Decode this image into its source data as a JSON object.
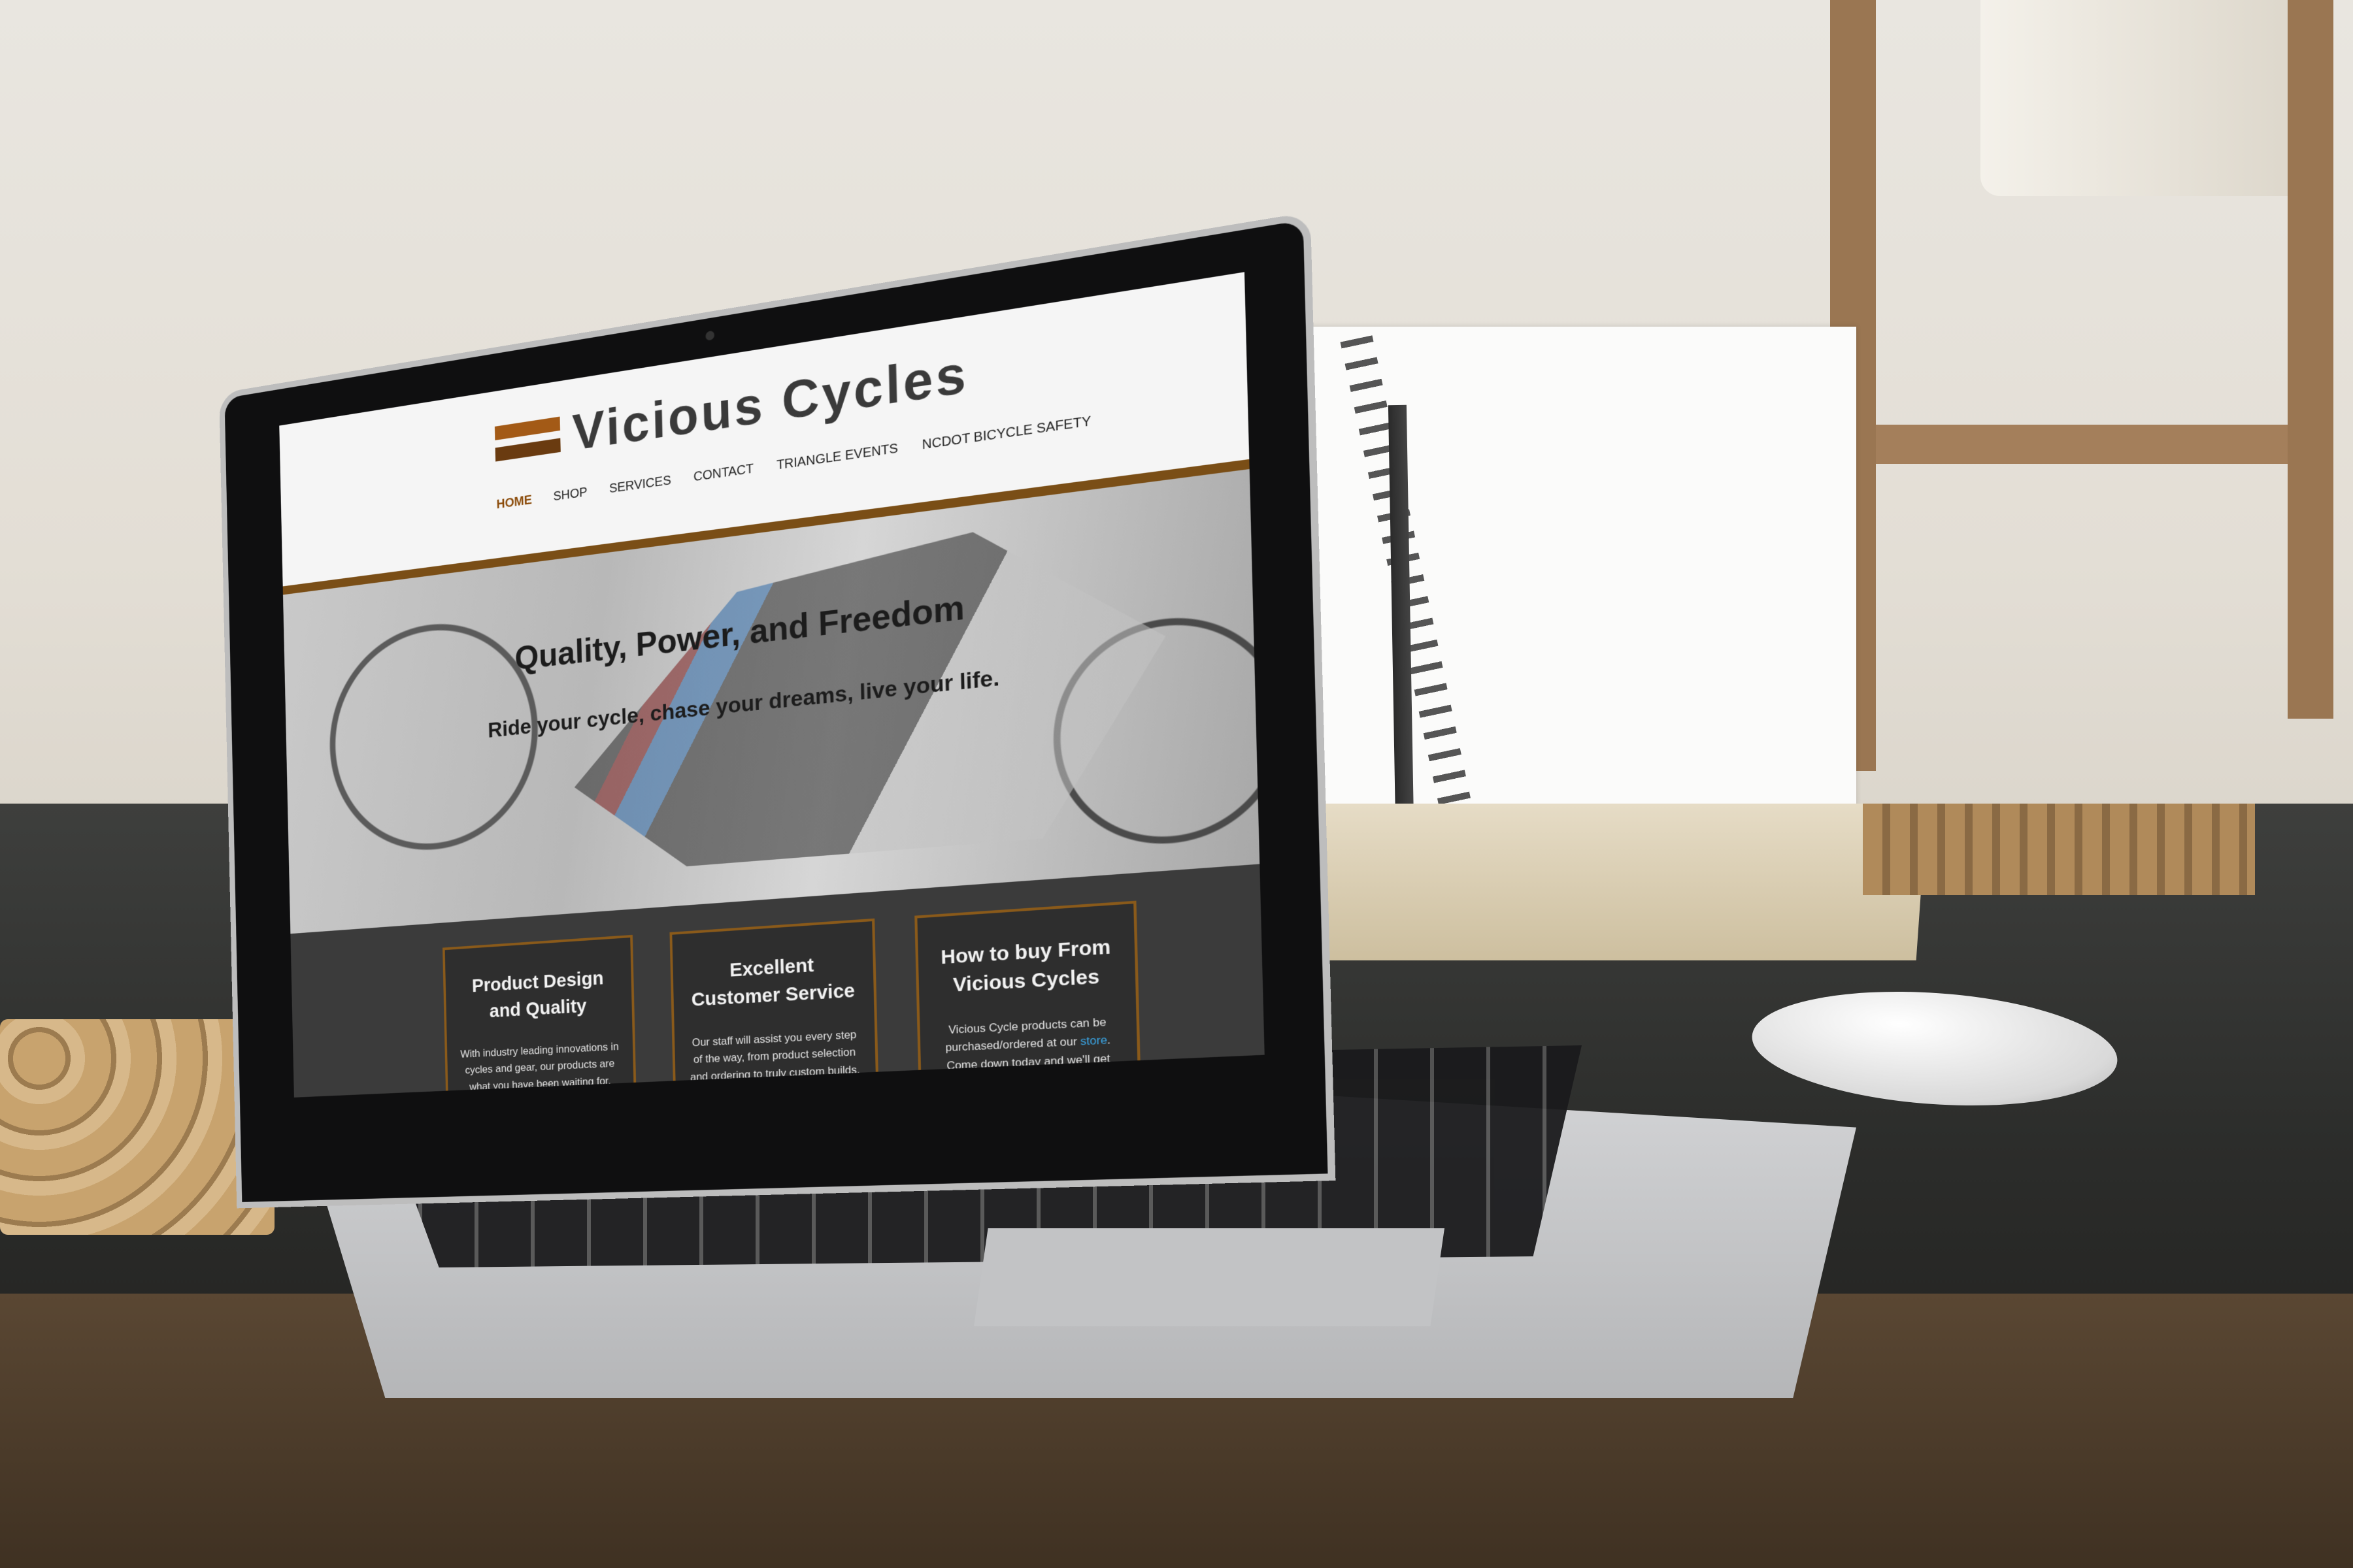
{
  "site": {
    "logo_text": "Vicious Cycles",
    "nav": [
      {
        "label": "HOME",
        "active": true
      },
      {
        "label": "SHOP"
      },
      {
        "label": "SERVICES"
      },
      {
        "label": "CONTACT"
      },
      {
        "label": "TRIANGLE EVENTS"
      },
      {
        "label": "NCDOT BICYCLE SAFETY"
      }
    ],
    "hero": {
      "title": "Quality, Power, and Freedom",
      "subtitle": "Ride your cycle, chase your dreams, live your life."
    },
    "cards": [
      {
        "title": "Product Design and Quality",
        "body": "With industry leading innovations in cycles and gear, our products are what you have been waiting for."
      },
      {
        "title": "Excellent Customer Service",
        "body": "Our staff will assist you every step of the way, from product selection and ordering to truly custom builds."
      },
      {
        "title": "How to buy From Vicious Cycles",
        "body_before": "Vicious Cycle products can be purchased/ordered at our ",
        "link": "store",
        "body_after": ". Come down today and we'll get started!"
      }
    ],
    "colors": {
      "accent_brown": "#7a4e16",
      "nav_active": "#8a4a08",
      "link_blue": "#3aa7e8",
      "page_dark": "#3b3b3b"
    }
  }
}
